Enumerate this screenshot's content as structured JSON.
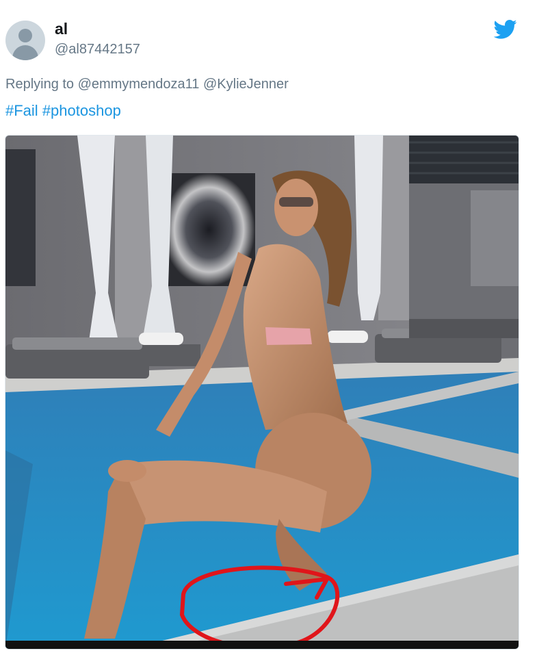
{
  "tweet": {
    "display_name": "al",
    "handle": "@al87442157",
    "reply_prefix": "Replying to",
    "reply_mentions": [
      "@emmymendoza11",
      "@KylieJenner"
    ],
    "hashtags": [
      "#Fail",
      "#photoshop"
    ]
  },
  "icons": {
    "platform": "twitter-bird-icon",
    "avatar": "default-profile-icon"
  },
  "colors": {
    "brand": "#1da1f2",
    "link": "#1b95e0",
    "muted": "#657786",
    "annotation": "#e0151a"
  }
}
